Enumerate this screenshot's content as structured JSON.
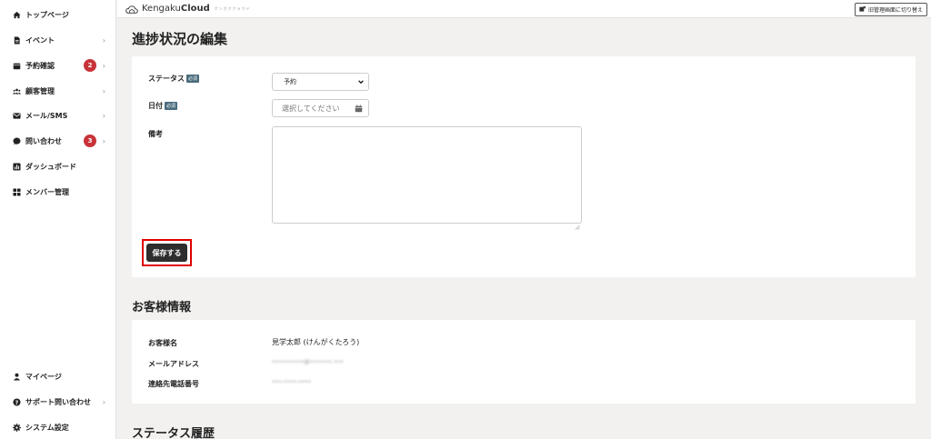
{
  "sidebar": {
    "items": [
      {
        "label": "トップページ"
      },
      {
        "label": "イベント",
        "chevron": "›"
      },
      {
        "label": "予約確認",
        "badge": "2",
        "chevron": "›"
      },
      {
        "label": "顧客管理",
        "chevron": "›"
      },
      {
        "label": "メール/SMS",
        "chevron": "›"
      },
      {
        "label": "問い合わせ",
        "badge": "3",
        "chevron": "›"
      },
      {
        "label": "ダッシュボード"
      },
      {
        "label": "メンバー管理"
      }
    ],
    "bottom_items": [
      {
        "label": "マイページ"
      },
      {
        "label": "サポート問い合わせ",
        "chevron": "›"
      },
      {
        "label": "システム設定"
      }
    ]
  },
  "header": {
    "brand_prefix": "Kengaku",
    "brand_bold": "Cloud",
    "tagline": "ケンガククラウド",
    "switch_label": "旧管理画面に切り替え"
  },
  "main": {
    "title": "進捗状況の編集",
    "form": {
      "status_label": "ステータス",
      "date_label": "日付",
      "required": "必須",
      "status_value": "予約",
      "date_placeholder": "選択してください",
      "note_label": "備考",
      "save_label": "保存する"
    },
    "customer_title": "お客様情報",
    "customer": {
      "name_label": "お客様名",
      "name_value": "見学太郎 (けんがくたろう)",
      "email_label": "メールアドレス",
      "email_value": "••••••••••@•••••••.•••",
      "phone_label": "連絡先電話番号",
      "phone_value": "•••-••••-••••"
    },
    "history_title": "ステータス履歴"
  },
  "colors": {
    "badge": "#c8343a",
    "highlight": "#e00000",
    "button": "#2e2e2e",
    "required_tag": "#4a6b7c"
  }
}
